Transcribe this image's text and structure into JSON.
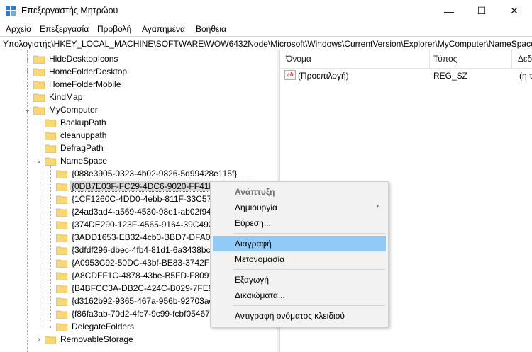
{
  "window": {
    "title": "Επεξεργαστής Μητρώου",
    "minimize_glyph": "—",
    "maximize_glyph": "☐",
    "close_glyph": "✕"
  },
  "menubar": [
    "Αρχείο",
    "Επεξεργασία",
    "Προβολή",
    "Αγαπημένα",
    "Βοήθεια"
  ],
  "address": "Υπολογιστής\\HKEY_LOCAL_MACHINE\\SOFTWARE\\WOW6432Node\\Microsoft\\Windows\\CurrentVersion\\Explorer\\MyComputer\\NameSpace",
  "tree": {
    "items": [
      {
        "label": "HideDesktopIcons",
        "chevron": "›"
      },
      {
        "label": "HomeFolderDesktop",
        "chevron": "›"
      },
      {
        "label": "HomeFolderMobile",
        "chevron": "›"
      },
      {
        "label": "KindMap",
        "chevron": ""
      },
      {
        "label": "MyComputer",
        "chevron": "⌄"
      },
      {
        "label": "BackupPath",
        "chevron": ""
      },
      {
        "label": "cleanuppath",
        "chevron": ""
      },
      {
        "label": "DefragPath",
        "chevron": ""
      },
      {
        "label": "NameSpace",
        "chevron": "⌄"
      },
      {
        "label": "{088e3905-0323-4b02-9826-5d99428e115f}",
        "chevron": ""
      },
      {
        "label": "{0DB7E03F-FC29-4DC6-9020-FF41B59E513A}",
        "chevron": ""
      },
      {
        "label": "{1CF1260C-4DD0-4ebb-811F-33C572699FDE}",
        "chevron": ""
      },
      {
        "label": "{24ad3ad4-a569-4530-98e1-ab02f9417aa8}",
        "chevron": ""
      },
      {
        "label": "{374DE290-123F-4565-9164-39C4925E467B}",
        "chevron": ""
      },
      {
        "label": "{3ADD1653-EB32-4cb0-BBD7-DFA0ABB5ACCA}",
        "chevron": ""
      },
      {
        "label": "{3dfdf296-dbec-4fb4-81d1-6a3438bcf4de}",
        "chevron": ""
      },
      {
        "label": "{A0953C92-50DC-43bf-BE83-3742FED03C9C}",
        "chevron": ""
      },
      {
        "label": "{A8CDFF1C-4878-43be-B5FD-F8091C1C60D0}",
        "chevron": ""
      },
      {
        "label": "{B4BFCC3A-DB2C-424C-B029-7FE99A87C641}",
        "chevron": ""
      },
      {
        "label": "{d3162b92-9365-467a-956b-92703aca08af}",
        "chevron": ""
      },
      {
        "label": "{f86fa3ab-70d2-4fc7-9c99-fcbf05467f3a}",
        "chevron": ""
      },
      {
        "label": "DelegateFolders",
        "chevron": "›"
      },
      {
        "label": "RemovableStorage",
        "chevron": "›"
      }
    ]
  },
  "list": {
    "columns": [
      "Όνομα",
      "Τύπος",
      "Δεδ"
    ],
    "rows": [
      {
        "icon": "ab",
        "name": "(Προεπιλογή)",
        "type": "REG_SZ",
        "data": "(η τιμ"
      }
    ]
  },
  "context_menu": {
    "items": [
      {
        "label": "Ανάπτυξη",
        "bold": true,
        "arrow": ""
      },
      {
        "label": "Δημιουργία",
        "bold": false,
        "arrow": "›"
      },
      {
        "label": "Εύρεση...",
        "bold": false,
        "arrow": ""
      },
      {
        "label": "Διαγραφή",
        "bold": false,
        "arrow": "",
        "hover": true
      },
      {
        "label": "Μετονομασία",
        "bold": false,
        "arrow": ""
      },
      {
        "label": "Εξαγωγή",
        "bold": false,
        "arrow": ""
      },
      {
        "label": "Δικαιώματα...",
        "bold": false,
        "arrow": ""
      },
      {
        "label": "Αντιγραφή ονόματος κλειδιού",
        "bold": false,
        "arrow": ""
      }
    ]
  },
  "colors": {
    "selection_hover": "#91c9f7",
    "folder_fill": "#f8d775",
    "folder_edge": "#e0b13c"
  }
}
